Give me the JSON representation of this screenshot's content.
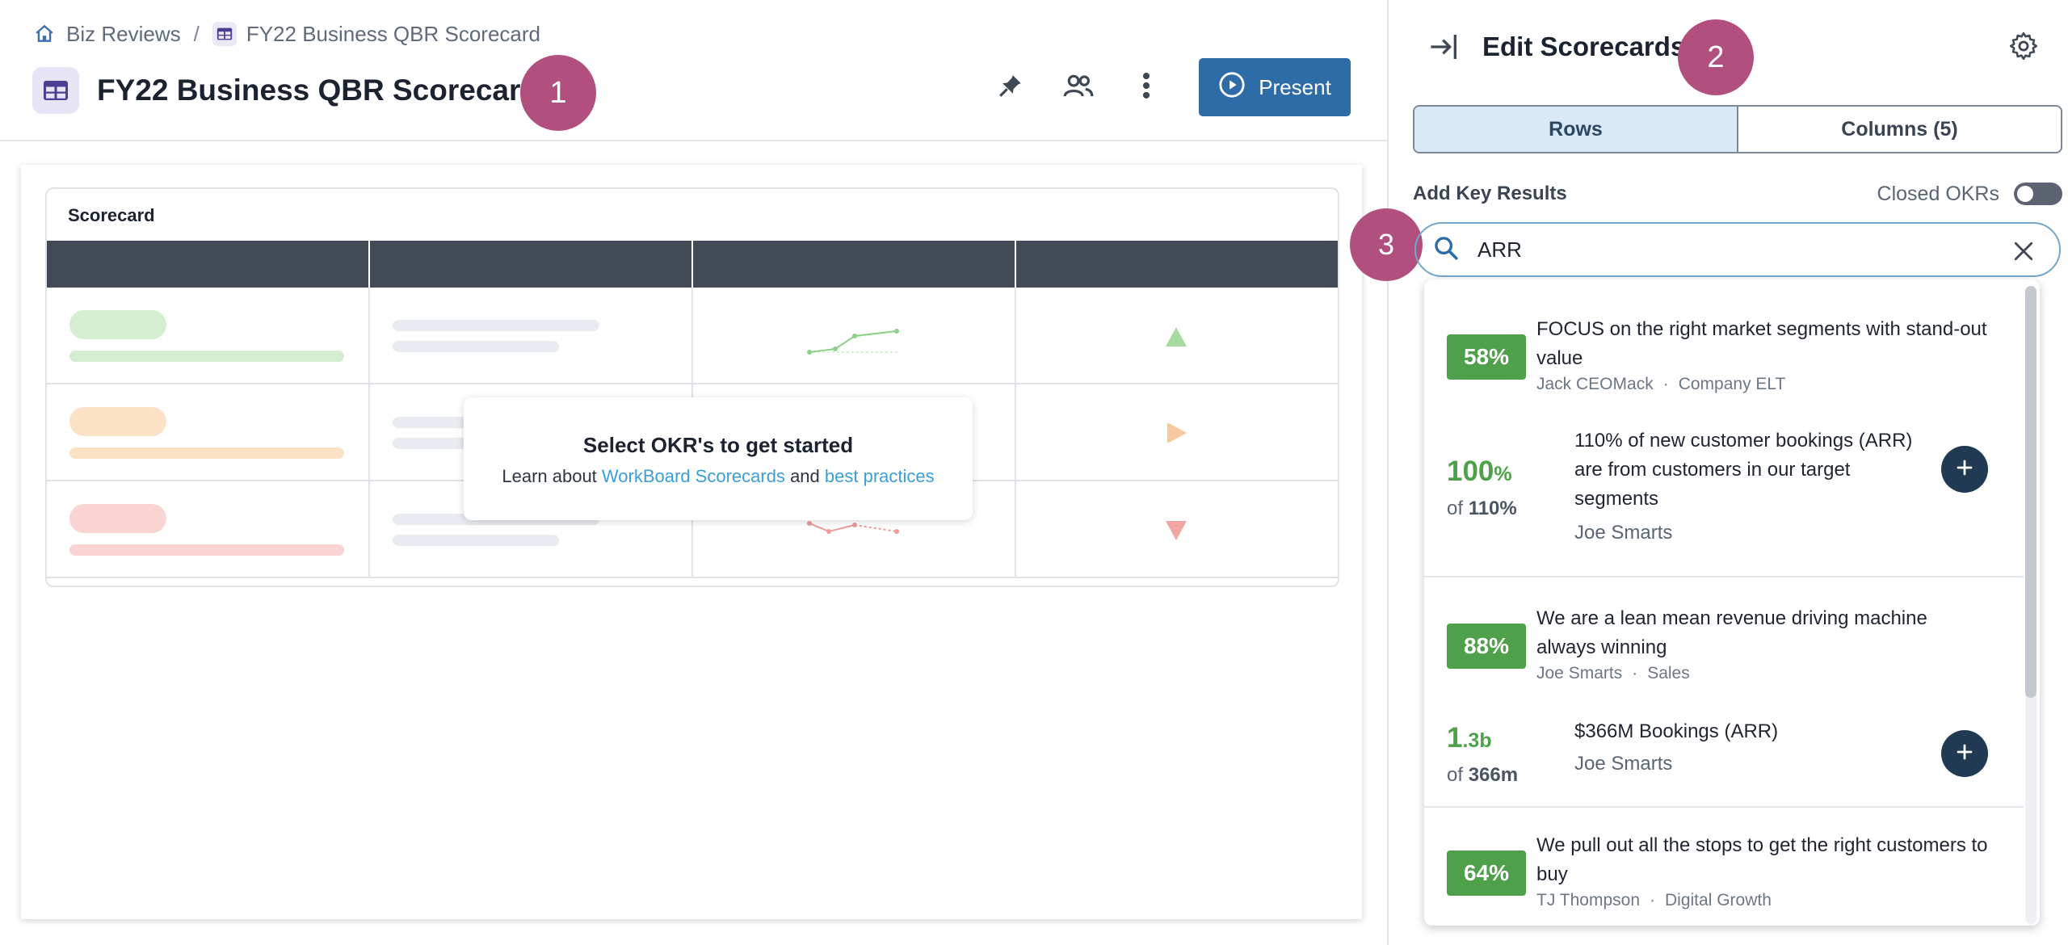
{
  "breadcrumb": {
    "root": "Biz Reviews",
    "separator": "/",
    "current": "FY22 Business QBR Scorecard"
  },
  "page": {
    "title": "FY22 Business QBR Scorecard",
    "present_label": "Present"
  },
  "callouts": [
    "1",
    "2",
    "3"
  ],
  "scorecard": {
    "title": "Scorecard",
    "empty_title": "Select OKR's to get started",
    "empty_prefix": "Learn about",
    "empty_link1": "WorkBoard Scorecards",
    "empty_and": "and",
    "empty_link2": "best practices",
    "row_colors": [
      "#4ea14a",
      "#e8a04c",
      "#e3625e"
    ]
  },
  "panel": {
    "title": "Edit Scorecards",
    "tabs": [
      {
        "label": "Rows",
        "active": true
      },
      {
        "label": "Columns (5)",
        "active": false
      }
    ],
    "add_key_results_label": "Add Key Results",
    "closed_okrs_label": "Closed OKRs",
    "closed_okrs_on": false,
    "search": {
      "value": "ARR"
    }
  },
  "results": [
    {
      "kind": "objective",
      "percent": "58%",
      "title": "FOCUS on the right market segments with stand-out value",
      "owner": "Jack CEOMack",
      "team": "Company ELT"
    },
    {
      "kind": "key_result",
      "value_main": "100",
      "value_unit": "%",
      "of_prefix": "of",
      "target": "110%",
      "title": "110% of new customer bookings (ARR) are from customers in our target segments",
      "owner": "Joe Smarts"
    },
    {
      "kind": "objective",
      "percent": "88%",
      "title": "We are a lean mean revenue driving machine always winning",
      "owner": "Joe Smarts",
      "team": "Sales"
    },
    {
      "kind": "key_result",
      "value_main": "1",
      "value_unit": ".3b",
      "of_prefix": "of",
      "target": "366m",
      "title": "$366M Bookings (ARR)",
      "owner": "Joe Smarts"
    },
    {
      "kind": "objective",
      "percent": "64%",
      "title": "We pull out all the stops to get the right customers to buy",
      "owner": "TJ Thompson",
      "team": "Digital Growth"
    }
  ],
  "icons": {
    "home": "home-icon",
    "grid": "table-icon",
    "pin": "pin-icon",
    "people": "people-icon",
    "more": "more-vertical-icon",
    "play": "play-circle-icon",
    "collapse": "collapse-panel-icon",
    "settings": "gear-icon",
    "search": "search-icon",
    "close": "close-icon",
    "add": "plus-icon"
  },
  "colors": {
    "accent": "#2e6ca8",
    "callout": "#b1507f",
    "success": "#4ea14a",
    "header_dark": "#424a56",
    "link": "#3a9fd8"
  }
}
